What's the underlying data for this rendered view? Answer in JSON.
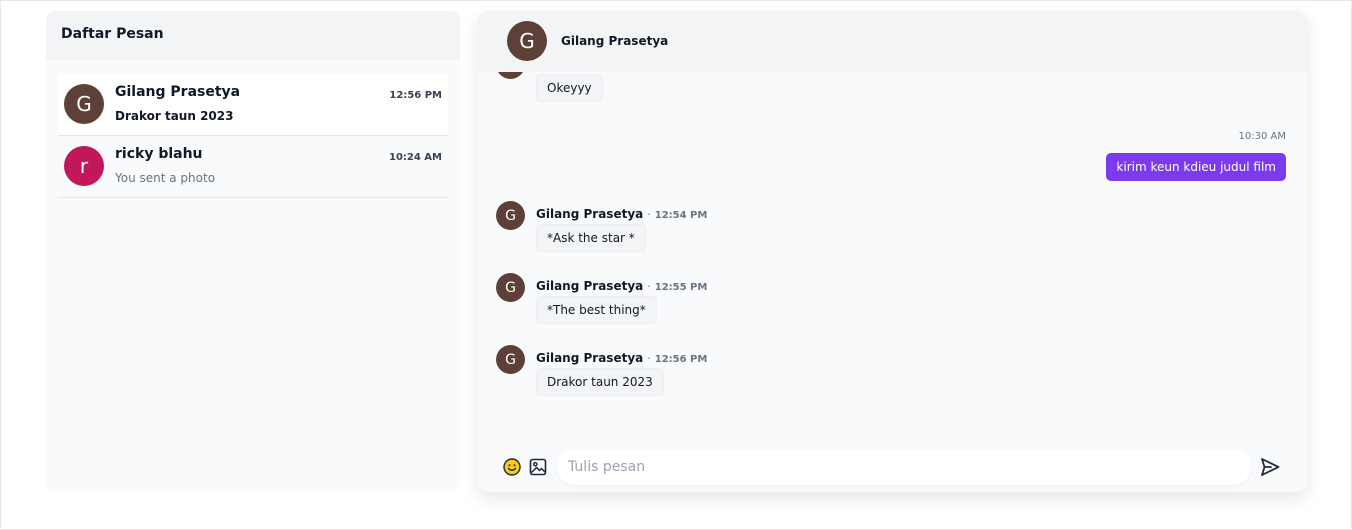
{
  "sidebar": {
    "title": "Daftar Pesan",
    "conversations": [
      {
        "initial": "G",
        "name": "Gilang Prasetya",
        "time": "12:56 PM",
        "preview": "Drakor taun 2023",
        "unread": true,
        "avatar_color": "#5d4037"
      },
      {
        "initial": "r",
        "name": "ricky blahu",
        "time": "10:24 AM",
        "preview": "You sent a photo",
        "unread": false,
        "avatar_color": "#c2185b"
      }
    ]
  },
  "chat": {
    "header": {
      "initial": "G",
      "name": "Gilang Prasetya"
    },
    "messages": [
      {
        "type": "in-cont",
        "text": "Okeyyy"
      },
      {
        "type": "out",
        "time": "10:30 AM",
        "text": "kirim keun kdieu judul film"
      },
      {
        "type": "in",
        "initial": "G",
        "sender": "Gilang Prasetya",
        "separator": "·",
        "time": "12:54 PM",
        "text": "*Ask the star *"
      },
      {
        "type": "in",
        "initial": "G",
        "sender": "Gilang Prasetya",
        "separator": "·",
        "time": "12:55 PM",
        "text": "*The best thing*"
      },
      {
        "type": "in",
        "initial": "G",
        "sender": "Gilang Prasetya",
        "separator": "·",
        "time": "12:56 PM",
        "text": "Drakor taun 2023"
      }
    ],
    "composer": {
      "placeholder": "Tulis pesan",
      "value": "",
      "icons": [
        "emoji-icon",
        "image-icon",
        "send-icon"
      ]
    }
  },
  "colors": {
    "accent": "#7c3aed",
    "avatar_brown": "#5d4037",
    "avatar_pink": "#c2185b",
    "emoji_yellow": "#facc15"
  }
}
